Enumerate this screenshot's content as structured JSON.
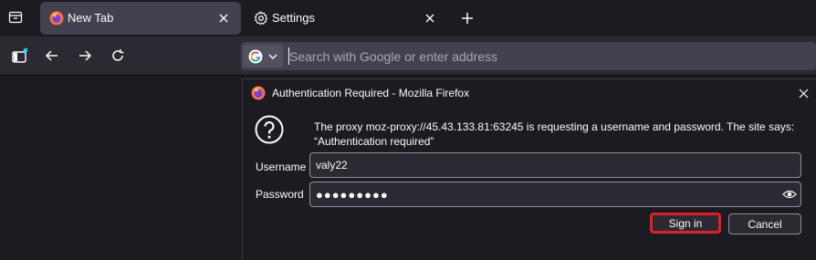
{
  "tabs": [
    {
      "label": "New Tab",
      "icon": "firefox-icon",
      "active": true
    },
    {
      "label": "Settings",
      "icon": "gear-icon",
      "active": false
    }
  ],
  "urlbar": {
    "placeholder": "Search with Google or enter address",
    "engine_icon": "google-icon"
  },
  "dialog": {
    "title": "Authentication Required - Mozilla Firefox",
    "message_line1": "The proxy moz-proxy://45.43.133.81:63245 is requesting a username and password. The site says:",
    "message_line2": "“Authentication required”",
    "username_label": "Username",
    "username_value": "valy22",
    "password_label": "Password",
    "password_masked": "●●●●●●●●●",
    "signin_label": "Sign in",
    "cancel_label": "Cancel"
  },
  "colors": {
    "highlight": "#e51c23",
    "chrome_bg": "#1c1b22",
    "toolbar_bg": "#2b2a33",
    "active_tab": "#42414d",
    "text": "#fbfbfe"
  }
}
